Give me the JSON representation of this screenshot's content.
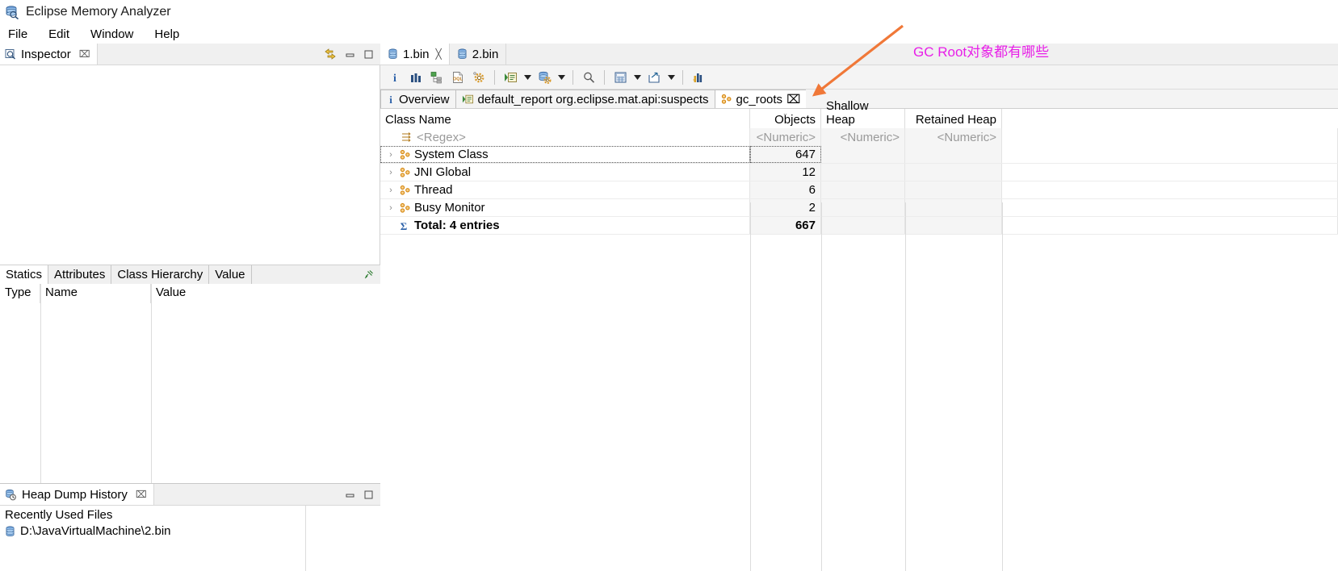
{
  "app": {
    "title": "Eclipse Memory Analyzer",
    "icon": "memory-analyzer-icon"
  },
  "menu": {
    "items": [
      {
        "label": "File"
      },
      {
        "label": "Edit"
      },
      {
        "label": "Window"
      },
      {
        "label": "Help"
      }
    ]
  },
  "inspector": {
    "tab_label": "Inspector",
    "close_label": "⌧",
    "icon": "inspector-icon",
    "buttons": [
      {
        "name": "link-with-editor-icon"
      },
      {
        "name": "minimize-icon"
      },
      {
        "name": "maximize-icon"
      }
    ],
    "property_tabs": [
      {
        "label": "Statics",
        "active": true
      },
      {
        "label": "Attributes",
        "active": false
      },
      {
        "label": "Class Hierarchy",
        "active": false
      },
      {
        "label": "Value",
        "active": false
      }
    ],
    "pin_icon": "pin-icon",
    "table_headers": [
      "Type",
      "Name",
      "Value"
    ],
    "rows": []
  },
  "heap_dump_history": {
    "tab_label": "Heap Dump History",
    "close_label": "⌧",
    "icon": "heap-dump-history-icon",
    "buttons": [
      {
        "name": "minimize-icon"
      },
      {
        "name": "maximize-icon"
      }
    ],
    "section_label": "Recently Used Files",
    "files": [
      {
        "label": "D:\\JavaVirtualMachine\\2.bin",
        "icon": "heap-dump-file-icon"
      }
    ]
  },
  "editor": {
    "tabs": [
      {
        "label": "1.bin",
        "active": true,
        "closable": true,
        "icon": "heap-dump-file-icon"
      },
      {
        "label": "2.bin",
        "active": false,
        "closable": false,
        "icon": "heap-dump-file-icon"
      }
    ],
    "toolbar": [
      {
        "name": "overview-info-icon",
        "type": "button"
      },
      {
        "name": "histogram-icon",
        "type": "button"
      },
      {
        "name": "dominator-tree-icon",
        "type": "button"
      },
      {
        "name": "oql-icon",
        "type": "button"
      },
      {
        "name": "inspect-gear-icon",
        "type": "button"
      },
      {
        "name": "separator",
        "type": "separator"
      },
      {
        "name": "run-report-icon",
        "type": "button"
      },
      {
        "name": "run-report-dropdown-arrow",
        "type": "arrow"
      },
      {
        "name": "query-browser-icon",
        "type": "button"
      },
      {
        "name": "query-browser-dropdown-arrow",
        "type": "arrow"
      },
      {
        "name": "separator",
        "type": "separator"
      },
      {
        "name": "search-icon",
        "type": "button"
      },
      {
        "name": "separator",
        "type": "separator"
      },
      {
        "name": "calculator-icon",
        "type": "button"
      },
      {
        "name": "calculator-dropdown-arrow",
        "type": "arrow"
      },
      {
        "name": "export-icon",
        "type": "button"
      },
      {
        "name": "export-dropdown-arrow",
        "type": "arrow"
      },
      {
        "name": "separator",
        "type": "separator"
      },
      {
        "name": "compare-icon",
        "type": "button"
      }
    ],
    "pane_tabs": [
      {
        "label": "Overview",
        "icon": "info-icon",
        "active": false,
        "closable": false
      },
      {
        "label": "default_report org.eclipse.mat.api:suspects",
        "icon": "report-icon",
        "active": false,
        "closable": false
      },
      {
        "label": "gc_roots",
        "icon": "gc-roots-icon",
        "active": true,
        "closable": true,
        "close_label": "⌧"
      }
    ]
  },
  "results_table": {
    "columns": [
      {
        "label": "Class Name",
        "align": "left",
        "sorted": false
      },
      {
        "label": "Objects",
        "align": "right",
        "sorted": true,
        "sort_caret": "⌄"
      },
      {
        "label": "Shallow Heap",
        "align": "right",
        "sorted": false
      },
      {
        "label": "Retained Heap",
        "align": "right",
        "sorted": false
      }
    ],
    "filter_row": {
      "class_name": "<Regex>",
      "objects": "<Numeric>",
      "shallow_heap": "<Numeric>",
      "retained_heap": "<Numeric>",
      "filter_icon": "regex-filter-icon"
    },
    "rows": [
      {
        "class_name": "System Class",
        "objects": "647",
        "shallow_heap": "",
        "retained_heap": "",
        "icon": "gc-roots-icon",
        "expandable": true,
        "focused": true
      },
      {
        "class_name": "JNI Global",
        "objects": "12",
        "shallow_heap": "",
        "retained_heap": "",
        "icon": "gc-roots-icon",
        "expandable": true,
        "focused": false
      },
      {
        "class_name": "Thread",
        "objects": "6",
        "shallow_heap": "",
        "retained_heap": "",
        "icon": "gc-roots-icon",
        "expandable": true,
        "focused": false
      },
      {
        "class_name": "Busy Monitor",
        "objects": "2",
        "shallow_heap": "",
        "retained_heap": "",
        "icon": "gc-roots-icon",
        "expandable": true,
        "focused": false
      }
    ],
    "total_row": {
      "class_name": "Total: 4 entries",
      "objects": "667",
      "shallow_heap": "",
      "retained_heap": "",
      "icon": "sum-sigma-icon"
    }
  },
  "annotation": {
    "text": "GC Root对象都有哪些",
    "color": "#e81ee8",
    "arrow_color": "#f07838",
    "arrow_name": "annotation-arrow"
  }
}
